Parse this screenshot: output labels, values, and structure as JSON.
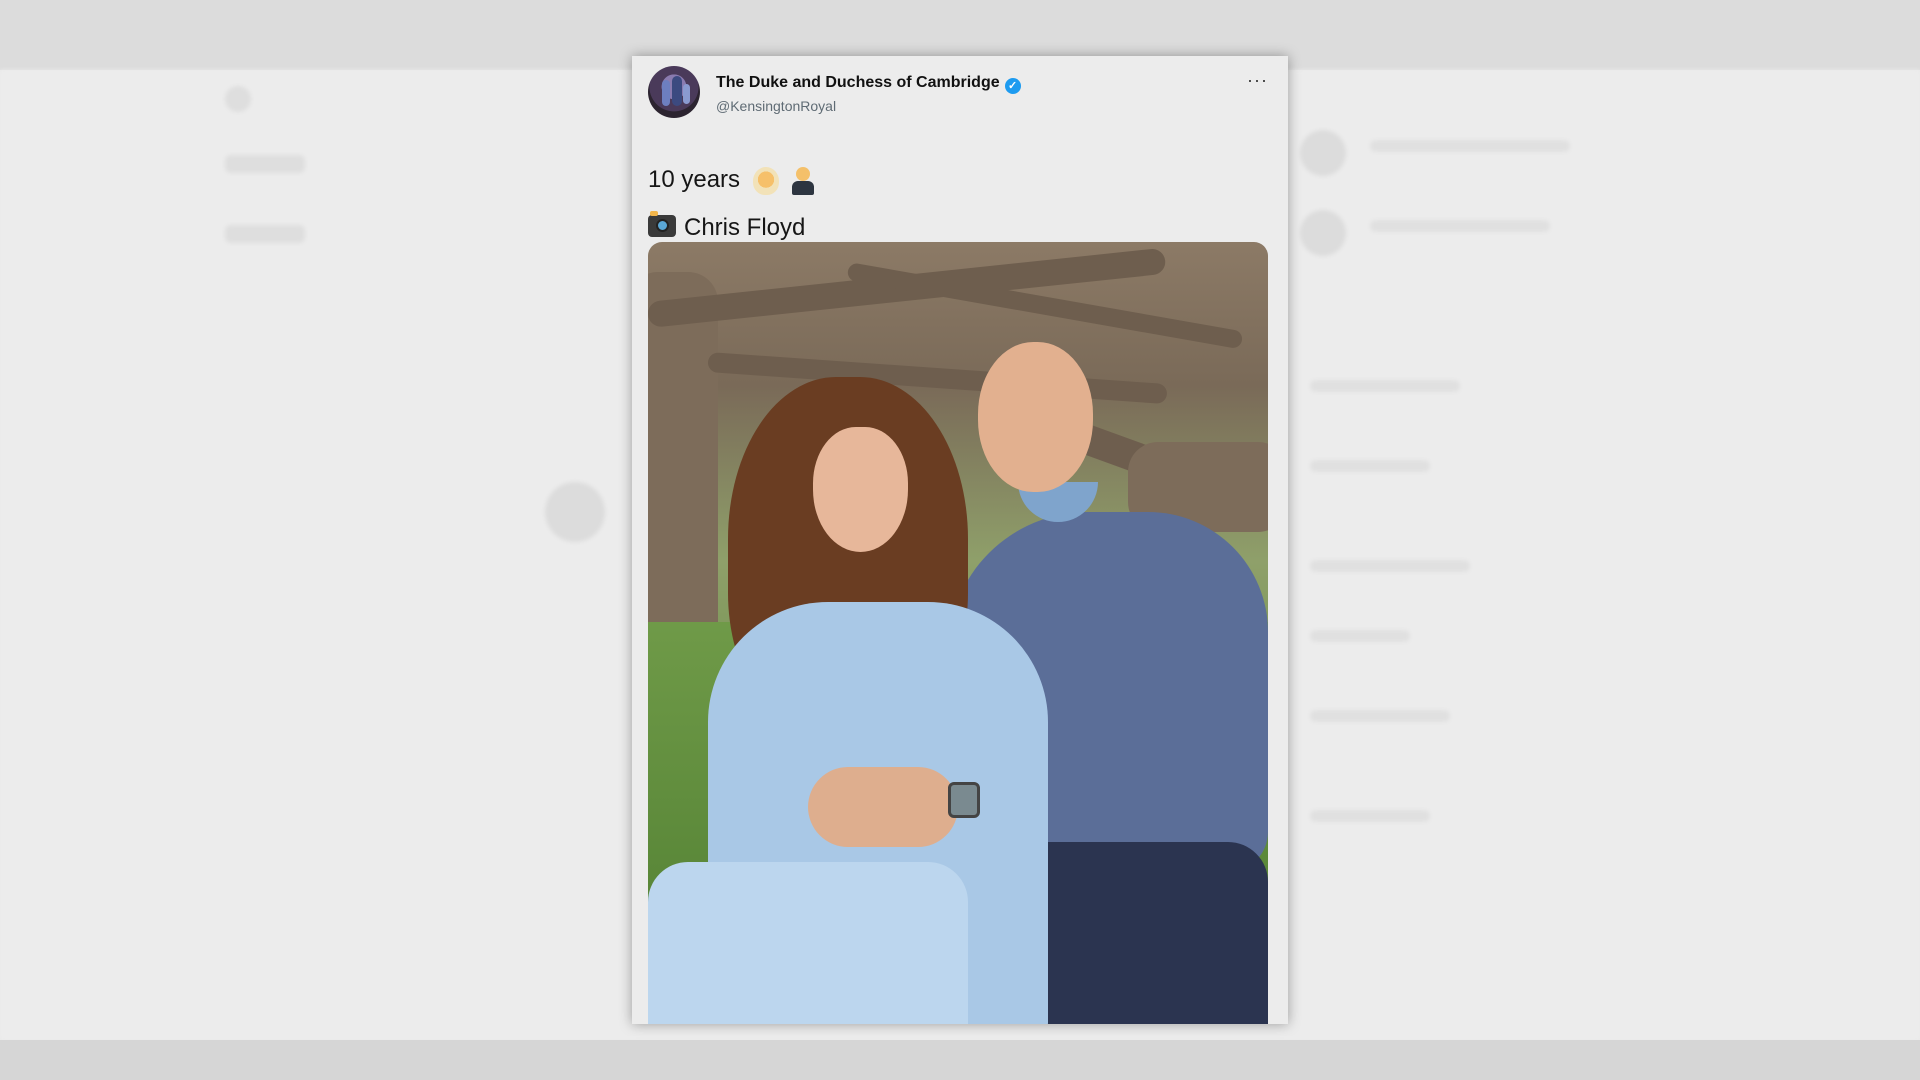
{
  "tweet": {
    "author_name": "The Duke and Duchess of Cambridge",
    "verified_glyph": "✓",
    "handle": "@KensingtonRoyal",
    "more_glyph": "···",
    "text_line1": "10 years",
    "emoji_1": "person-with-veil-emoji",
    "emoji_2": "person-in-tuxedo-emoji",
    "camera_icon": "camera-with-flash-icon",
    "credit": "Chris Floyd",
    "accent_color": "#1d9bf0"
  }
}
